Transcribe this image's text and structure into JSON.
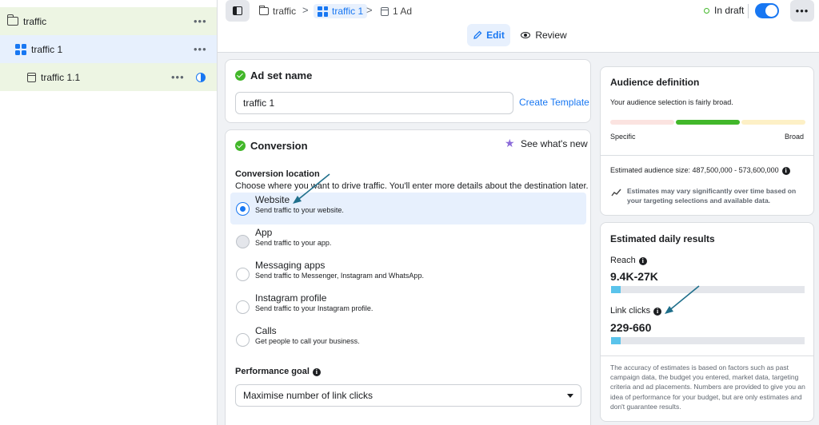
{
  "sidebar": {
    "items": [
      {
        "label": "traffic",
        "icon": "folder-icon",
        "menu": "•••"
      },
      {
        "label": "traffic 1",
        "icon": "ad-set-grid-icon",
        "menu": "•••"
      },
      {
        "label": "traffic 1.1",
        "icon": "ad-icon",
        "menu": "•••",
        "status_icon": "half-circle-status-icon"
      }
    ]
  },
  "topbar": {
    "breadcrumbs": [
      {
        "label": "traffic",
        "icon": "folder-icon"
      },
      {
        "label": "traffic 1",
        "icon": "ad-set-grid-icon"
      },
      {
        "label": "1 Ad",
        "icon": "ad-icon"
      }
    ],
    "separator": ">",
    "status": "In draft",
    "toggle_on": true,
    "more_label": "•••",
    "edit_label": "Edit",
    "review_label": "Review"
  },
  "ad_set": {
    "title": "Ad set name",
    "name_value": "traffic 1",
    "create_template": "Create Template"
  },
  "conversion": {
    "title": "Conversion",
    "whats_new": "See what's new",
    "location_label": "Conversion location",
    "location_desc": "Choose where you want to drive traffic. You'll enter more details about the destination later.",
    "options": [
      {
        "label": "Website",
        "sub": "Send traffic to your website.",
        "selected": true
      },
      {
        "label": "App",
        "sub": "Send traffic to your app.",
        "selected": false
      },
      {
        "label": "Messaging apps",
        "sub": "Send traffic to Messenger, Instagram and WhatsApp.",
        "selected": false
      },
      {
        "label": "Instagram profile",
        "sub": "Send traffic to your Instagram profile.",
        "selected": false
      },
      {
        "label": "Calls",
        "sub": "Get people to call your business.",
        "selected": false
      }
    ],
    "goal_label": "Performance goal",
    "goal_value": "Maximise number of link clicks"
  },
  "audience": {
    "title": "Audience definition",
    "summary": "Your audience selection is fairly broad.",
    "specific": "Specific",
    "broad": "Broad",
    "size": "Estimated audience size: 487,500,000 - 573,600,000",
    "note": "Estimates may vary significantly over time based on your targeting selections and available data.",
    "colors": {
      "low": "#fbe3e0",
      "mid": "#42b72a",
      "high": "#fdf0c6"
    }
  },
  "daily": {
    "title": "Estimated daily results",
    "reach_label": "Reach",
    "reach_value": "9.4K-27K",
    "reach_fill": 0.05,
    "clicks_label": "Link clicks",
    "clicks_value": "229-660",
    "clicks_fill": 0.05,
    "disclaimer": "The accuracy of estimates is based on factors such as past campaign data, the budget you entered, market data, targeting criteria and ad placements. Numbers are provided to give you an idea of performance for your budget, but are only estimates and don't guarantee results."
  }
}
